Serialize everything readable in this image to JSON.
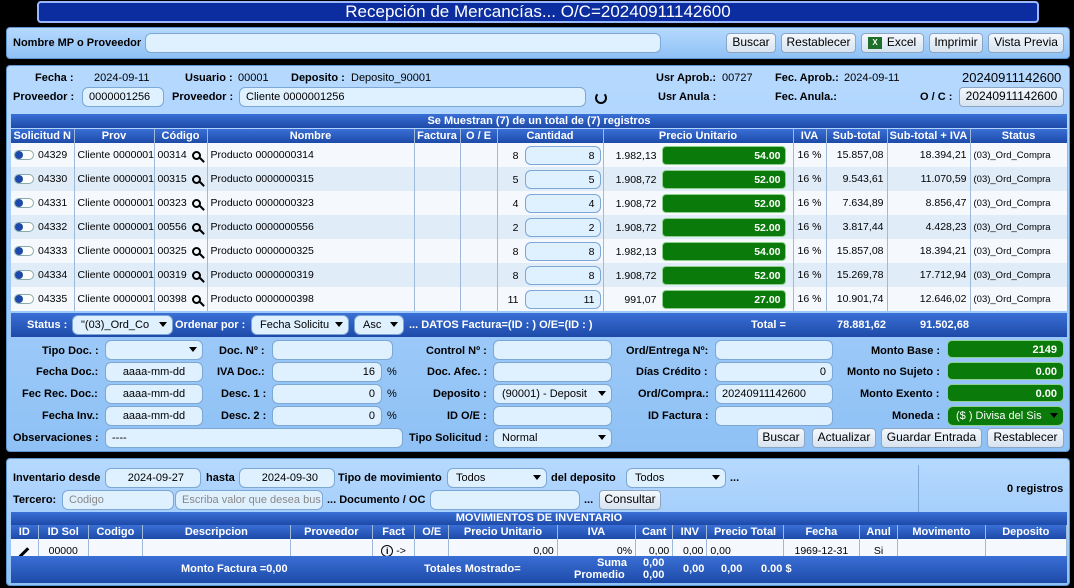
{
  "title": "Recepción de Mercancías... O/C=20240911142600",
  "search": {
    "label": "Nombre MP o Proveedor",
    "value": "",
    "buttons": {
      "buscar": "Buscar",
      "restablecer": "Restablecer",
      "excel": "Excel",
      "imprimir": "Imprimir",
      "vista": "Vista Previa"
    }
  },
  "header": {
    "fecha_label": "Fecha :",
    "fecha": "2024-09-11",
    "usuario_label": "Usuario :",
    "usuario": "00001",
    "deposito_label": "Deposito :",
    "deposito": "Deposito_90001",
    "usr_aprob_label": "Usr Aprob.:",
    "usr_aprob": "00727",
    "fec_aprob_label": "Fec. Aprob.:",
    "fec_aprob": "2024-09-11",
    "oc_number": "20240911142600",
    "proveedor_label": "Proveedor :",
    "proveedor_code": "0000001256",
    "proveedor2_label": "Proveedor :",
    "proveedor_name": "Cliente 0000001256",
    "usr_anula_label": "Usr Anula :",
    "fec_anula_label": "Fec. Anula.:",
    "oc_label": "O / C :",
    "oc_button": "20240911142600"
  },
  "grid": {
    "caption": "Se Muestran (7) de un total de (7) registros",
    "columns": [
      "Solicitud N",
      "Prov",
      "Código",
      "Nombre",
      "Factura",
      "O / E",
      "Cantidad",
      "Precio Unitario",
      "IVA",
      "Sub-total",
      "Sub-total + IVA",
      "Status"
    ],
    "rows": [
      {
        "sol": "04329",
        "prov": "Cliente 0000001",
        "cod": "00314",
        "nombre": "Producto 0000000314",
        "cant": "8",
        "cant_in": "8",
        "precio": "1.982,13",
        "precio_in": "54.00",
        "iva": "16 %",
        "sub": "15.857,08",
        "subiva": "18.394,21",
        "status": "(03)_Ord_Compra"
      },
      {
        "sol": "04330",
        "prov": "Cliente 0000001",
        "cod": "00315",
        "nombre": "Producto 0000000315",
        "cant": "5",
        "cant_in": "5",
        "precio": "1.908,72",
        "precio_in": "52.00",
        "iva": "16 %",
        "sub": "9.543,61",
        "subiva": "11.070,59",
        "status": "(03)_Ord_Compra"
      },
      {
        "sol": "04331",
        "prov": "Cliente 0000001",
        "cod": "00323",
        "nombre": "Producto 0000000323",
        "cant": "4",
        "cant_in": "4",
        "precio": "1.908,72",
        "precio_in": "52.00",
        "iva": "16 %",
        "sub": "7.634,89",
        "subiva": "8.856,47",
        "status": "(03)_Ord_Compra"
      },
      {
        "sol": "04332",
        "prov": "Cliente 0000001",
        "cod": "00556",
        "nombre": "Producto 0000000556",
        "cant": "2",
        "cant_in": "2",
        "precio": "1.908,72",
        "precio_in": "52.00",
        "iva": "16 %",
        "sub": "3.817,44",
        "subiva": "4.428,23",
        "status": "(03)_Ord_Compra"
      },
      {
        "sol": "04333",
        "prov": "Cliente 0000001",
        "cod": "00325",
        "nombre": "Producto 0000000325",
        "cant": "8",
        "cant_in": "8",
        "precio": "1.982,13",
        "precio_in": "54.00",
        "iva": "16 %",
        "sub": "15.857,08",
        "subiva": "18.394,21",
        "status": "(03)_Ord_Compra"
      },
      {
        "sol": "04334",
        "prov": "Cliente 0000001",
        "cod": "00319",
        "nombre": "Producto 0000000319",
        "cant": "8",
        "cant_in": "8",
        "precio": "1.908,72",
        "precio_in": "52.00",
        "iva": "16 %",
        "sub": "15.269,78",
        "subiva": "17.712,94",
        "status": "(03)_Ord_Compra"
      },
      {
        "sol": "04335",
        "prov": "Cliente 0000001",
        "cod": "00398",
        "nombre": "Producto 0000000398",
        "cant": "11",
        "cant_in": "11",
        "precio": "991,07",
        "precio_in": "27.00",
        "iva": "16 %",
        "sub": "10.901,74",
        "subiva": "12.646,02",
        "status": "(03)_Ord_Compra"
      }
    ],
    "footer": {
      "status_label": "Status :",
      "status_value": "\"(03)_Ord_Co",
      "ordenar_label": "Ordenar por :",
      "ordenar_value": "Fecha Solicitu",
      "asc": "Asc",
      "datos": "... DATOS Factura=(ID : ) O/E=(ID : )",
      "total_label": "Total =",
      "total_sub": "78.881,62",
      "total_iva": "91.502,68"
    }
  },
  "form": {
    "tipo_doc": "Tipo Doc. :",
    "doc_n": "Doc. Nº :",
    "control_n": "Control Nº :",
    "ord_entrega": "Ord/Entrega Nº:",
    "monto_base_label": "Monto Base :",
    "monto_base": "2149",
    "fecha_doc": "Fecha Doc.:",
    "fecha_doc_ph": "aaaa-mm-dd",
    "iva_doc": "IVA Doc.:",
    "iva_doc_val": "16",
    "doc_afec": "Doc. Afec. :",
    "dias_credito": "Días Crédito :",
    "dias_credito_val": "0",
    "monto_no_sujeto_label": "Monto no Sujeto :",
    "monto_no_sujeto": "0.00",
    "fec_rec_doc": "Fec Rec. Doc.:",
    "fec_rec_ph": "aaaa-mm-dd",
    "desc1": "Desc. 1 :",
    "desc1_val": "0",
    "deposito": "Deposito :",
    "deposito_val": "(90001) - Deposit",
    "ord_compra": "Ord/Compra.:",
    "ord_compra_val": "20240911142600",
    "monto_exento_label": "Monto Exento :",
    "monto_exento": "0.00",
    "fecha_inv": "Fecha Inv.:",
    "fecha_inv_ph": "aaaa-mm-dd",
    "desc2": "Desc. 2 :",
    "desc2_val": "0",
    "id_oe": "ID O/E :",
    "id_factura": "ID Factura :",
    "moneda_label": "Moneda :",
    "moneda_val": "($ ) Divisa del Sis",
    "observaciones": "Observaciones :",
    "obs_val": "----",
    "tipo_solicitud": "Tipo Solicitud :",
    "tipo_solicitud_val": "Normal",
    "percent": "%",
    "buttons": {
      "buscar": "Buscar",
      "actualizar": "Actualizar",
      "guardar": "Guardar Entrada",
      "restablecer": "Restablecer"
    }
  },
  "inventario": {
    "desde_label": "Inventario desde",
    "desde": "2024-09-27",
    "hasta_label": "hasta",
    "hasta": "2024-09-30",
    "tipo_mov_label": "Tipo de movimiento",
    "tipo_mov": "Todos",
    "del_deposito_label": "del deposito",
    "deposito": "Todos",
    "ellipsis": "...",
    "tercero_label": "Tercero:",
    "tercero_ph": "Codigo",
    "valor_ph": "Escriba valor que desea bus",
    "doc_label": "... Documento / OC",
    "consultar": "Consultar",
    "registros": "0 registros",
    "caption": "MOVIMIENTOS DE INVENTARIO",
    "columns": [
      "ID",
      "ID Sol",
      "Codigo",
      "Descripcion",
      "Proveedor",
      "Fact",
      "O/E",
      "Precio Unitario",
      "IVA",
      "Cant",
      "INV",
      "Precio Total",
      "Fecha",
      "Anul",
      "Movimento",
      "Deposito"
    ],
    "row": {
      "id_sol": "00000",
      "arrow": "->",
      "precio": "0,00",
      "iva": "0%",
      "cant": "0,00",
      "inv": "0,00",
      "total": "0,00",
      "fecha": "1969-12-31",
      "anul": "Si"
    },
    "footer": {
      "monto_factura": "Monto Factura =0,00",
      "totales": "Totales Mostrado=",
      "suma": "Suma",
      "promedio": "Promedio",
      "v1": "0,00",
      "v2": "0,00",
      "v3": "0,00",
      "v4": "0,00",
      "v5": "0.00 $"
    }
  }
}
